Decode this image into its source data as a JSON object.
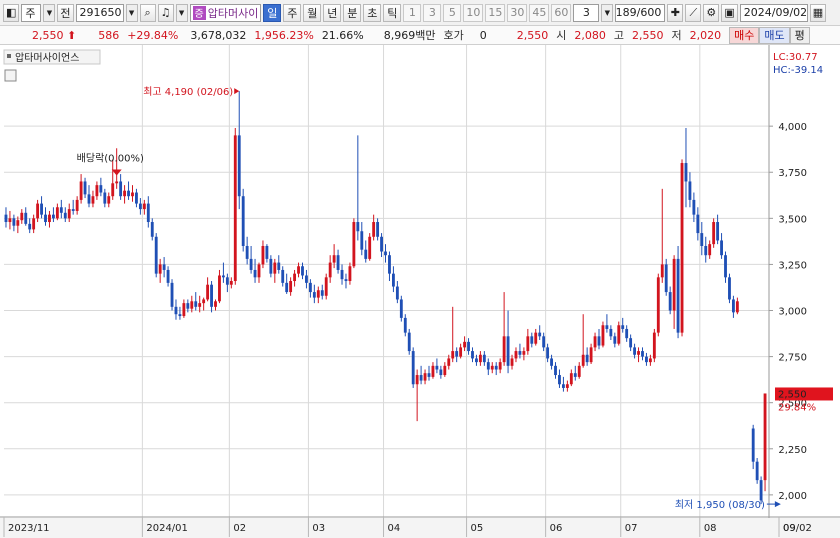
{
  "toolbar": {
    "market": "주",
    "type_label": "전",
    "code": "291650",
    "badge": "증",
    "stock_name": "압타머사이",
    "periods": [
      {
        "label": "일",
        "active": true
      },
      {
        "label": "주",
        "active": false
      },
      {
        "label": "월",
        "active": false
      },
      {
        "label": "년",
        "active": false
      },
      {
        "label": "분",
        "active": false
      },
      {
        "label": "초",
        "active": false
      },
      {
        "label": "틱",
        "active": false
      }
    ],
    "intervals": [
      "1",
      "3",
      "5",
      "10",
      "15",
      "30",
      "45",
      "60"
    ],
    "interval_value": "3",
    "count": "189/600",
    "date": "2024/09/02"
  },
  "info": {
    "price": "2,550",
    "change": "586",
    "change_pct": "+29.84%",
    "volume": "3,678,032",
    "volume_pct": "1,956.23%",
    "turnover": "21.66%",
    "amount": "8,969백만",
    "hoga_label": "호가",
    "hoga_value": "0",
    "hoga_price": "2,550",
    "open_label": "시",
    "open": "2,080",
    "high_label": "고",
    "high": "2,550",
    "low_label": "저",
    "low": "2,020",
    "buy_label": "매수",
    "sell_label": "매도",
    "misc_label": "평"
  },
  "colors": {
    "up": "#d2141e",
    "down": "#1f4fb5",
    "grid": "#d9d9d9",
    "price_tag": "#e0141e"
  },
  "chart_data": {
    "type": "candlestick",
    "title": "압타머사이언스",
    "lc_label": "LC:30.77",
    "hc_label": "HC:-39.14",
    "ylim": [
      1880,
      4310
    ],
    "yticks": [
      2000,
      2250,
      2500,
      2750,
      3000,
      3250,
      3500,
      3750,
      4000
    ],
    "ytick_labels": [
      "2,000",
      "2,250",
      "2,500",
      "2,750",
      "3,000",
      "3,250",
      "3,500",
      "3,750",
      "4,000"
    ],
    "x_labels": [
      {
        "label": "2023/11",
        "index": 0
      },
      {
        "label": "2024/01",
        "index": 35
      },
      {
        "label": "02",
        "index": 57
      },
      {
        "label": "03",
        "index": 77
      },
      {
        "label": "04",
        "index": 96
      },
      {
        "label": "05",
        "index": 117
      },
      {
        "label": "06",
        "index": 137
      },
      {
        "label": "07",
        "index": 156
      },
      {
        "label": "08",
        "index": 176
      },
      {
        "label": "09",
        "index": 198
      },
      {
        "label": "09/02",
        "index": 207
      }
    ],
    "current_price": 2550,
    "current_price_label": "2,550",
    "current_change_label": "29.84%",
    "annotations": {
      "high": {
        "text": "최고 4,190 (02/06)",
        "value": 4190,
        "index": 59
      },
      "low": {
        "text": "최저 1,950 (08/30)",
        "value": 1950,
        "index": 196
      },
      "dividend": {
        "text": "배당락(0.00%)",
        "value": 3700,
        "index": 28
      }
    },
    "candles": [
      [
        3520,
        3560,
        3450,
        3480
      ],
      [
        3480,
        3540,
        3440,
        3500
      ],
      [
        3500,
        3520,
        3430,
        3460
      ],
      [
        3460,
        3510,
        3420,
        3490
      ],
      [
        3490,
        3550,
        3470,
        3530
      ],
      [
        3530,
        3560,
        3460,
        3470
      ],
      [
        3470,
        3500,
        3420,
        3440
      ],
      [
        3440,
        3520,
        3420,
        3500
      ],
      [
        3500,
        3600,
        3480,
        3580
      ],
      [
        3580,
        3620,
        3500,
        3520
      ],
      [
        3520,
        3560,
        3460,
        3480
      ],
      [
        3480,
        3540,
        3450,
        3520
      ],
      [
        3520,
        3560,
        3480,
        3500
      ],
      [
        3500,
        3580,
        3490,
        3560
      ],
      [
        3560,
        3600,
        3500,
        3530
      ],
      [
        3530,
        3560,
        3480,
        3500
      ],
      [
        3500,
        3580,
        3480,
        3550
      ],
      [
        3550,
        3600,
        3520,
        3540
      ],
      [
        3540,
        3620,
        3520,
        3600
      ],
      [
        3600,
        3740,
        3580,
        3700
      ],
      [
        3700,
        3720,
        3610,
        3630
      ],
      [
        3630,
        3680,
        3560,
        3580
      ],
      [
        3580,
        3650,
        3560,
        3620
      ],
      [
        3620,
        3700,
        3600,
        3680
      ],
      [
        3680,
        3720,
        3620,
        3640
      ],
      [
        3640,
        3660,
        3560,
        3580
      ],
      [
        3580,
        3640,
        3560,
        3620
      ],
      [
        3620,
        3820,
        3600,
        3690
      ],
      [
        3690,
        3880,
        3660,
        3700
      ],
      [
        3700,
        3740,
        3600,
        3620
      ],
      [
        3620,
        3680,
        3580,
        3650
      ],
      [
        3650,
        3700,
        3600,
        3620
      ],
      [
        3620,
        3680,
        3590,
        3640
      ],
      [
        3640,
        3660,
        3560,
        3580
      ],
      [
        3580,
        3610,
        3520,
        3550
      ],
      [
        3550,
        3600,
        3520,
        3580
      ],
      [
        3580,
        3620,
        3450,
        3480
      ],
      [
        3480,
        3500,
        3380,
        3400
      ],
      [
        3400,
        3420,
        3180,
        3200
      ],
      [
        3200,
        3280,
        3150,
        3250
      ],
      [
        3250,
        3290,
        3180,
        3220
      ],
      [
        3220,
        3240,
        3130,
        3150
      ],
      [
        3150,
        3170,
        3000,
        3020
      ],
      [
        3020,
        3060,
        2950,
        2980
      ],
      [
        2980,
        3020,
        2950,
        2970
      ],
      [
        2970,
        3060,
        2960,
        3040
      ],
      [
        3040,
        3060,
        2990,
        3010
      ],
      [
        3010,
        3080,
        2990,
        3050
      ],
      [
        3050,
        3100,
        3000,
        3020
      ],
      [
        3020,
        3080,
        2990,
        3040
      ],
      [
        3040,
        3070,
        3000,
        3060
      ],
      [
        3060,
        3180,
        3050,
        3140
      ],
      [
        3140,
        3160,
        2990,
        3020
      ],
      [
        3020,
        3060,
        3000,
        3050
      ],
      [
        3050,
        3220,
        3040,
        3190
      ],
      [
        3190,
        3260,
        3150,
        3180
      ],
      [
        3180,
        3200,
        3100,
        3140
      ],
      [
        3140,
        3180,
        3120,
        3160
      ],
      [
        3160,
        3990,
        3140,
        3950
      ],
      [
        3950,
        4190,
        3550,
        3620
      ],
      [
        3620,
        3660,
        3320,
        3350
      ],
      [
        3350,
        3400,
        3250,
        3280
      ],
      [
        3280,
        3350,
        3200,
        3220
      ],
      [
        3220,
        3280,
        3150,
        3180
      ],
      [
        3180,
        3260,
        3150,
        3250
      ],
      [
        3250,
        3380,
        3230,
        3350
      ],
      [
        3350,
        3360,
        3260,
        3280
      ],
      [
        3280,
        3300,
        3180,
        3200
      ],
      [
        3200,
        3280,
        3150,
        3260
      ],
      [
        3260,
        3300,
        3200,
        3220
      ],
      [
        3220,
        3240,
        3130,
        3150
      ],
      [
        3150,
        3200,
        3090,
        3100
      ],
      [
        3100,
        3180,
        3080,
        3160
      ],
      [
        3160,
        3220,
        3130,
        3200
      ],
      [
        3200,
        3260,
        3180,
        3240
      ],
      [
        3240,
        3260,
        3170,
        3190
      ],
      [
        3190,
        3220,
        3120,
        3150
      ],
      [
        3150,
        3170,
        3070,
        3100
      ],
      [
        3100,
        3140,
        3040,
        3070
      ],
      [
        3070,
        3130,
        3040,
        3110
      ],
      [
        3110,
        3140,
        3060,
        3080
      ],
      [
        3080,
        3200,
        3060,
        3180
      ],
      [
        3180,
        3300,
        3150,
        3260
      ],
      [
        3260,
        3360,
        3230,
        3300
      ],
      [
        3300,
        3330,
        3200,
        3220
      ],
      [
        3220,
        3250,
        3140,
        3170
      ],
      [
        3170,
        3200,
        3120,
        3160
      ],
      [
        3160,
        3260,
        3140,
        3240
      ],
      [
        3240,
        3500,
        3230,
        3480
      ],
      [
        3480,
        3950,
        3380,
        3430
      ],
      [
        3430,
        3480,
        3300,
        3330
      ],
      [
        3330,
        3380,
        3260,
        3280
      ],
      [
        3280,
        3420,
        3270,
        3400
      ],
      [
        3400,
        3520,
        3380,
        3480
      ],
      [
        3480,
        3500,
        3380,
        3400
      ],
      [
        3400,
        3420,
        3290,
        3320
      ],
      [
        3320,
        3360,
        3260,
        3300
      ],
      [
        3300,
        3320,
        3160,
        3200
      ],
      [
        3200,
        3240,
        3100,
        3130
      ],
      [
        3130,
        3160,
        3040,
        3060
      ],
      [
        3060,
        3080,
        2940,
        2960
      ],
      [
        2960,
        2980,
        2860,
        2880
      ],
      [
        2880,
        2900,
        2760,
        2780
      ],
      [
        2780,
        2800,
        2580,
        2600
      ],
      [
        2600,
        2680,
        2400,
        2650
      ],
      [
        2650,
        2700,
        2600,
        2620
      ],
      [
        2620,
        2680,
        2600,
        2660
      ],
      [
        2660,
        2700,
        2620,
        2640
      ],
      [
        2640,
        2720,
        2630,
        2700
      ],
      [
        2700,
        2740,
        2660,
        2680
      ],
      [
        2680,
        2700,
        2630,
        2650
      ],
      [
        2650,
        2720,
        2640,
        2700
      ],
      [
        2700,
        2760,
        2680,
        2740
      ],
      [
        2740,
        3020,
        2720,
        2780
      ],
      [
        2780,
        2800,
        2720,
        2750
      ],
      [
        2750,
        2820,
        2740,
        2800
      ],
      [
        2800,
        2860,
        2780,
        2830
      ],
      [
        2830,
        2850,
        2760,
        2780
      ],
      [
        2780,
        2800,
        2720,
        2740
      ],
      [
        2740,
        2760,
        2700,
        2720
      ],
      [
        2720,
        2780,
        2700,
        2760
      ],
      [
        2760,
        2780,
        2700,
        2720
      ],
      [
        2720,
        2740,
        2650,
        2680
      ],
      [
        2680,
        2720,
        2660,
        2700
      ],
      [
        2700,
        2720,
        2650,
        2680
      ],
      [
        2680,
        2740,
        2660,
        2720
      ],
      [
        2720,
        3100,
        2700,
        2860
      ],
      [
        2860,
        3000,
        2660,
        2700
      ],
      [
        2700,
        2760,
        2680,
        2740
      ],
      [
        2740,
        2800,
        2720,
        2780
      ],
      [
        2780,
        2820,
        2740,
        2760
      ],
      [
        2760,
        2800,
        2730,
        2780
      ],
      [
        2780,
        2900,
        2760,
        2860
      ],
      [
        2860,
        2880,
        2800,
        2820
      ],
      [
        2820,
        2900,
        2810,
        2880
      ],
      [
        2880,
        2920,
        2840,
        2860
      ],
      [
        2860,
        2880,
        2780,
        2800
      ],
      [
        2800,
        2820,
        2720,
        2740
      ],
      [
        2740,
        2760,
        2680,
        2700
      ],
      [
        2700,
        2720,
        2630,
        2650
      ],
      [
        2650,
        2680,
        2580,
        2600
      ],
      [
        2600,
        2640,
        2560,
        2580
      ],
      [
        2580,
        2620,
        2560,
        2600
      ],
      [
        2600,
        2680,
        2590,
        2660
      ],
      [
        2660,
        2700,
        2620,
        2640
      ],
      [
        2640,
        2720,
        2630,
        2700
      ],
      [
        2700,
        2980,
        2690,
        2760
      ],
      [
        2760,
        2800,
        2700,
        2720
      ],
      [
        2720,
        2820,
        2710,
        2800
      ],
      [
        2800,
        2880,
        2780,
        2860
      ],
      [
        2860,
        2900,
        2790,
        2810
      ],
      [
        2810,
        2940,
        2800,
        2920
      ],
      [
        2920,
        2980,
        2880,
        2900
      ],
      [
        2900,
        2920,
        2840,
        2860
      ],
      [
        2860,
        2880,
        2800,
        2820
      ],
      [
        2820,
        2940,
        2810,
        2920
      ],
      [
        2920,
        2960,
        2880,
        2900
      ],
      [
        2900,
        2920,
        2830,
        2850
      ],
      [
        2850,
        2870,
        2780,
        2800
      ],
      [
        2800,
        2820,
        2740,
        2760
      ],
      [
        2760,
        2800,
        2720,
        2780
      ],
      [
        2780,
        2800,
        2730,
        2750
      ],
      [
        2750,
        2770,
        2700,
        2720
      ],
      [
        2720,
        2760,
        2700,
        2740
      ],
      [
        2740,
        2900,
        2720,
        2880
      ],
      [
        2880,
        3200,
        2860,
        3180
      ],
      [
        3180,
        3660,
        3150,
        3250
      ],
      [
        3250,
        3280,
        3080,
        3100
      ],
      [
        3100,
        3130,
        2980,
        3000
      ],
      [
        3000,
        3300,
        2900,
        3280
      ],
      [
        3280,
        3350,
        2850,
        2880
      ],
      [
        2880,
        3820,
        2860,
        3800
      ],
      [
        3800,
        3990,
        3560,
        3700
      ],
      [
        3700,
        3750,
        3560,
        3600
      ],
      [
        3600,
        3640,
        3480,
        3520
      ],
      [
        3520,
        3560,
        3380,
        3420
      ],
      [
        3420,
        3480,
        3300,
        3350
      ],
      [
        3350,
        3400,
        3260,
        3300
      ],
      [
        3300,
        3380,
        3280,
        3360
      ],
      [
        3360,
        3500,
        3340,
        3480
      ],
      [
        3480,
        3520,
        3360,
        3380
      ],
      [
        3380,
        3420,
        3280,
        3300
      ],
      [
        3300,
        3320,
        3150,
        3180
      ],
      [
        3180,
        3200,
        3040,
        3060
      ],
      [
        3060,
        3080,
        2960,
        2990
      ],
      [
        2990,
        3070,
        2980,
        3050
      ],
      null,
      null,
      null,
      [
        2360,
        2380,
        2140,
        2180
      ],
      [
        2180,
        2200,
        2060,
        2080
      ],
      [
        2080,
        2100,
        1950,
        1970
      ],
      [
        2080,
        2550,
        2020,
        2550
      ]
    ]
  }
}
